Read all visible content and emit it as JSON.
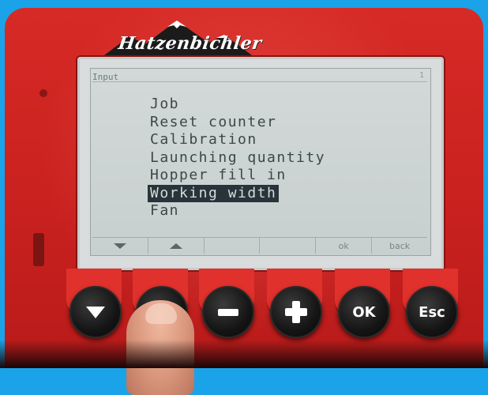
{
  "brand": {
    "logo_text": "Hatzenbichler"
  },
  "lcd": {
    "title": "Input",
    "corner": "1",
    "menu_items": [
      "Job",
      "Reset counter",
      "Calibration",
      "Launching quantity",
      "Hopper fill in",
      "Working width",
      "Fan"
    ],
    "selected_index": 5,
    "softkeys": [
      {
        "label": "",
        "icon": "down-triangle-icon"
      },
      {
        "label": "",
        "icon": "up-triangle-icon"
      },
      {
        "label": ""
      },
      {
        "label": ""
      },
      {
        "label": "ok"
      },
      {
        "label": "back"
      }
    ]
  },
  "buttons": [
    {
      "name": "down-button",
      "icon": "down-arrow-icon"
    },
    {
      "name": "up-button",
      "icon": "up-arrow-icon"
    },
    {
      "name": "minus-button",
      "icon": "minus-icon"
    },
    {
      "name": "plus-button",
      "icon": "plus-icon"
    },
    {
      "name": "ok-button",
      "label": "OK"
    },
    {
      "name": "esc-button",
      "label": "Esc"
    }
  ],
  "colors": {
    "device_red": "#c9211f",
    "background": "#1aa3e8",
    "lcd": "#cdd5d4"
  }
}
